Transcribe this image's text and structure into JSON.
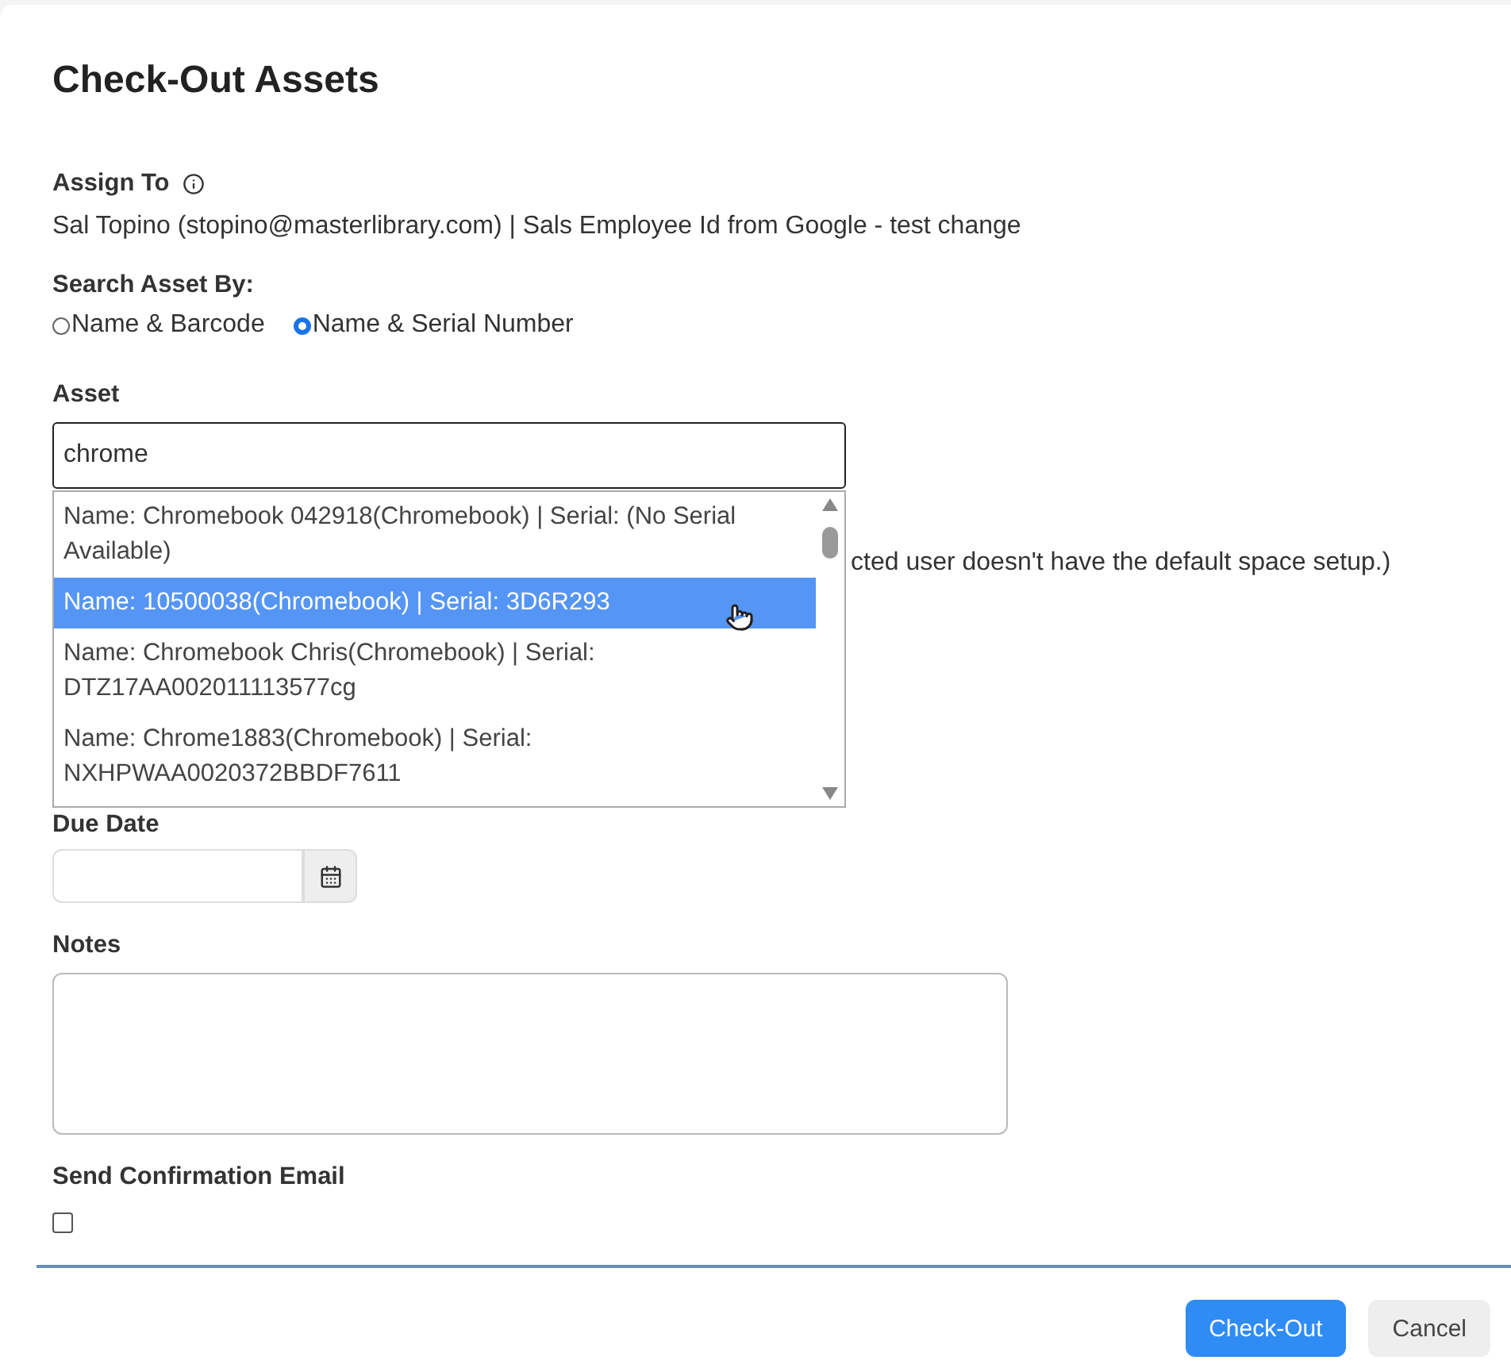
{
  "dialog": {
    "title": "Check-Out Assets"
  },
  "assign_to": {
    "label": "Assign To",
    "value": "Sal Topino (stopino@masterlibrary.com) | Sals Employee Id from Google - test change"
  },
  "search_by": {
    "label": "Search Asset By:",
    "options": [
      {
        "label": "Name & Barcode",
        "selected": false
      },
      {
        "label": "Name & Serial Number",
        "selected": true
      }
    ]
  },
  "asset": {
    "label": "Asset",
    "value": "chrome",
    "suggestions": [
      {
        "text": "Name: Chromebook 042918(Chromebook) | Serial: (No Serial Available)",
        "selected": false
      },
      {
        "text": "Name: 10500038(Chromebook) | Serial: 3D6R293",
        "selected": true
      },
      {
        "text": "Name: Chromebook Chris(Chromebook) | Serial: DTZ17AA002011113577cg",
        "selected": false
      },
      {
        "text": "Name: Chrome1883(Chromebook) | Serial: NXHPWAA0020372BBDF7611",
        "selected": false
      }
    ]
  },
  "hidden_note": "cted user doesn't have the default space setup.)",
  "due_date": {
    "label": "Due Date"
  },
  "notes": {
    "label": "Notes"
  },
  "send_email": {
    "label": "Send Confirmation Email",
    "checked": false
  },
  "buttons": [
    {
      "label": "Check-Out",
      "kind": "primary"
    },
    {
      "label": "Cancel",
      "kind": "secondary"
    }
  ]
}
